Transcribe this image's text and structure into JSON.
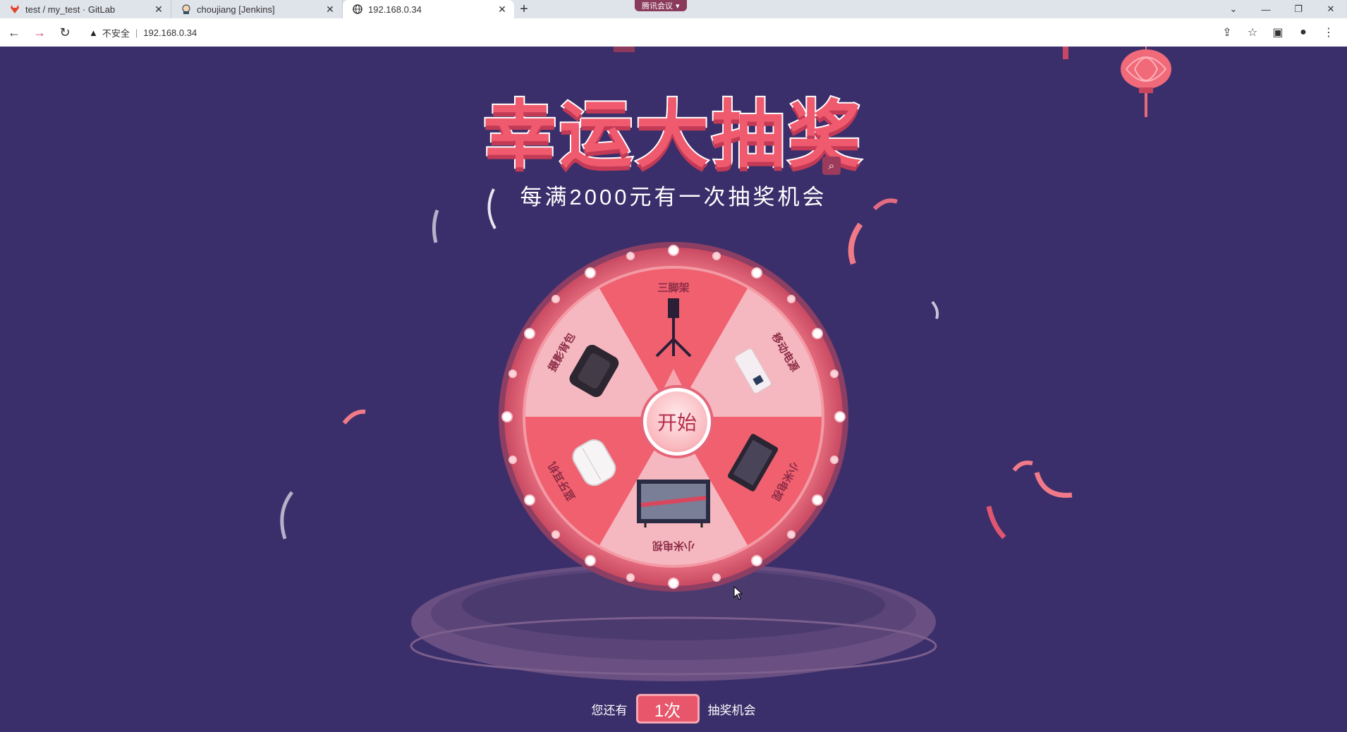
{
  "browser": {
    "tabs": [
      {
        "label": "test / my_test · GitLab",
        "icon": "gitlab-icon"
      },
      {
        "label": "choujiang [Jenkins]",
        "icon": "jenkins-icon"
      },
      {
        "label": "192.168.0.34",
        "icon": "globe-icon",
        "active": true
      }
    ],
    "meeting_badge": "腾讯会议",
    "security_label": "不安全",
    "url": "192.168.0.34"
  },
  "page": {
    "title": "幸运大抽奖",
    "subtitle": "每满2000元有一次抽奖机会",
    "start_label": "开始",
    "prizes": [
      "三脚架",
      "移动电源",
      "小米电视",
      "小米电视",
      "蓝牙耳机",
      "摄影背包"
    ],
    "prize_labels_visible": {
      "top": "三脚架",
      "top_right": "移动电源",
      "bottom_right": "小米电视",
      "bottom": "小米电视",
      "bottom_left": "蓝牙耳机",
      "top_left": "摄影背包"
    },
    "chances_prefix": "您还有",
    "chances_count": "1次",
    "chances_suffix": "抽奖机会"
  },
  "colors": {
    "background": "#3b2f6b",
    "accent": "#f05a6e",
    "slice_light": "#f6b3bb",
    "slice_dark": "#f0606f"
  }
}
